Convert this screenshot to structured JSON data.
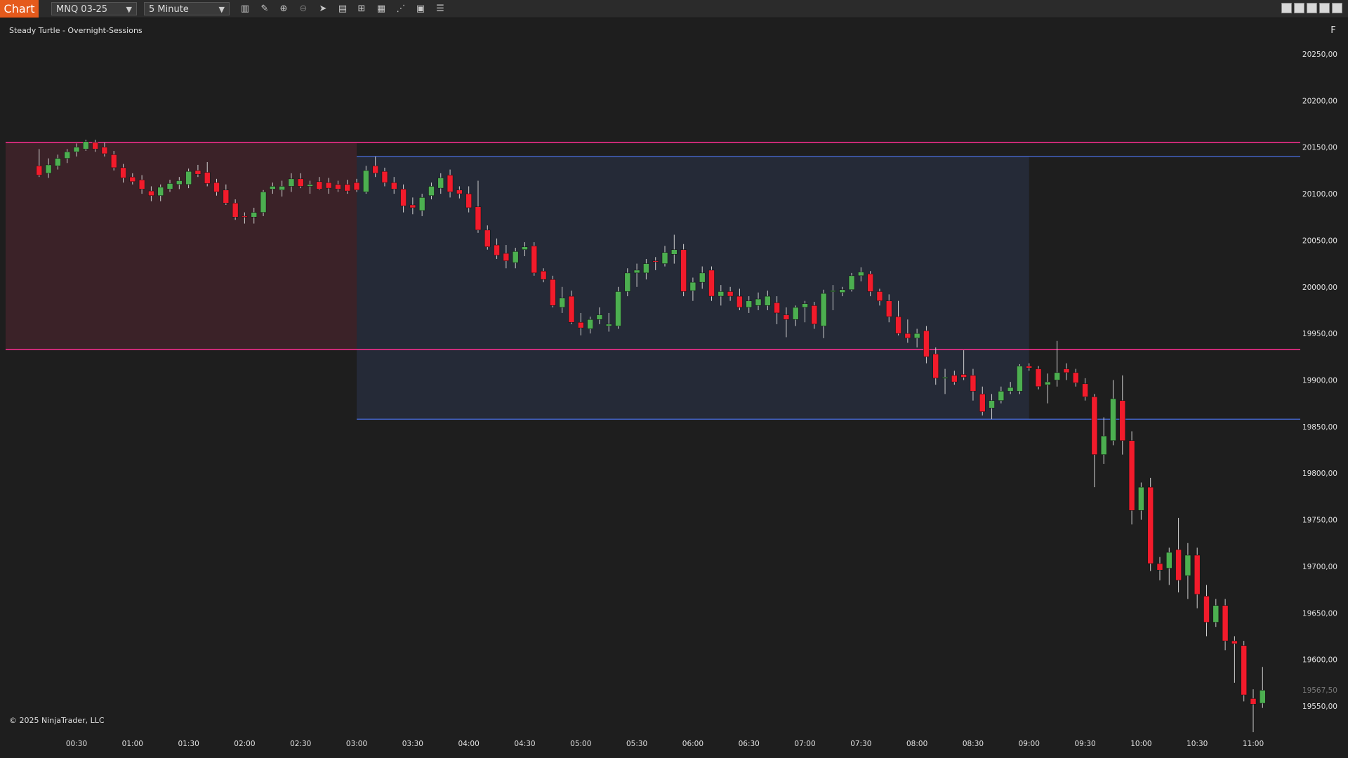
{
  "toolbar": {
    "chart_tab": "Chart",
    "instrument": "MNQ 03-25",
    "interval": "5 Minute",
    "tools": [
      "bars-icon",
      "draw-icon",
      "zoom-in-icon",
      "zoom-out-icon",
      "pointer-icon",
      "data-box-icon",
      "properties-icon",
      "templates-icon",
      "strategies-icon",
      "indicators-icon",
      "list-icon"
    ]
  },
  "indicator_label": "Steady Turtle - Overnight-Sessions",
  "copyright": "© 2025 NinjaTrader, LLC",
  "f_button": "F",
  "colors": {
    "background": "#1e1e1e",
    "up_candle": "#4caf50",
    "down_candle": "#f21b2b",
    "session_red_zone": "#3b2228",
    "session_blue_zone": "#252a37",
    "magenta_line": "#ff2f92",
    "blue_line": "#4a6fe0"
  },
  "chart_data": {
    "type": "candlestick",
    "title": "",
    "y_ticks": [
      "20250,00",
      "20200,00",
      "20150,00",
      "20100,00",
      "20050,00",
      "20000,00",
      "19950,00",
      "19900,00",
      "19850,00",
      "19800,00",
      "19750,00",
      "19700,00",
      "19650,00",
      "19600,00",
      "19550,00"
    ],
    "current_price_label": "19567,50",
    "x_ticks": [
      "00:30",
      "01:00",
      "01:30",
      "02:00",
      "02:30",
      "03:00",
      "03:30",
      "04:00",
      "04:30",
      "05:00",
      "05:30",
      "06:00",
      "06:30",
      "07:00",
      "07:30",
      "08:00",
      "08:30",
      "09:00",
      "09:30",
      "10:00",
      "10:30",
      "11:00"
    ],
    "ylim": [
      19520,
      20280
    ],
    "levels": {
      "overnight_high": 20155,
      "overnight_low": 19933,
      "range_high": 20140,
      "range_low": 19858
    },
    "zones": [
      {
        "name": "overnight",
        "start": "00:00",
        "end": "03:00",
        "top": 20155,
        "bottom": 19933
      },
      {
        "name": "london",
        "start": "03:00",
        "end": "09:00",
        "top": 20140,
        "bottom": 19858
      }
    ],
    "candles": [
      [
        "00:10",
        20130,
        20148,
        20118,
        20120
      ],
      [
        "00:15",
        20122,
        20138,
        20117,
        20131
      ],
      [
        "00:20",
        20130,
        20142,
        20126,
        20138
      ],
      [
        "00:25",
        20138,
        20148,
        20133,
        20145
      ],
      [
        "00:30",
        20145,
        20154,
        20140,
        20150
      ],
      [
        "00:35",
        20148,
        20158,
        20146,
        20156
      ],
      [
        "00:40",
        20155,
        20158,
        20145,
        20148
      ],
      [
        "00:45",
        20150,
        20155,
        20140,
        20143
      ],
      [
        "00:50",
        20142,
        20146,
        20125,
        20128
      ],
      [
        "00:55",
        20128,
        20132,
        20112,
        20117
      ],
      [
        "01:00",
        20118,
        20122,
        20110,
        20113
      ],
      [
        "01:05",
        20115,
        20120,
        20100,
        20105
      ],
      [
        "01:10",
        20103,
        20108,
        20092,
        20098
      ],
      [
        "01:15",
        20098,
        20110,
        20092,
        20107
      ],
      [
        "01:20",
        20105,
        20115,
        20102,
        20111
      ],
      [
        "01:25",
        20110,
        20118,
        20105,
        20114
      ],
      [
        "01:30",
        20110,
        20127,
        20106,
        20124
      ],
      [
        "01:35",
        20125,
        20131,
        20118,
        20121
      ],
      [
        "01:40",
        20123,
        20134,
        20108,
        20111
      ],
      [
        "01:45",
        20112,
        20116,
        20098,
        20102
      ],
      [
        "01:50",
        20104,
        20110,
        20088,
        20090
      ],
      [
        "01:55",
        20090,
        20094,
        20072,
        20075
      ],
      [
        "02:00",
        20076,
        20080,
        20068,
        20075
      ],
      [
        "02:05",
        20075,
        20085,
        20068,
        20080
      ],
      [
        "02:10",
        20080,
        20104,
        20076,
        20102
      ],
      [
        "02:15",
        20105,
        20112,
        20100,
        20108
      ],
      [
        "02:20",
        20104,
        20114,
        20097,
        20108
      ],
      [
        "02:25",
        20108,
        20122,
        20102,
        20116
      ],
      [
        "02:30",
        20116,
        20122,
        20106,
        20108
      ],
      [
        "02:35",
        20108,
        20114,
        20100,
        20110
      ],
      [
        "02:40",
        20113,
        20118,
        20104,
        20105
      ],
      [
        "02:45",
        20112,
        20117,
        20100,
        20106
      ],
      [
        "02:50",
        20110,
        20114,
        20102,
        20105
      ],
      [
        "02:55",
        20110,
        20115,
        20100,
        20103
      ],
      [
        "03:00",
        20112,
        20116,
        20102,
        20104
      ],
      [
        "03:05",
        20102,
        20130,
        20100,
        20125
      ],
      [
        "03:10",
        20130,
        20140,
        20118,
        20122
      ],
      [
        "03:15",
        20124,
        20128,
        20108,
        20112
      ],
      [
        "03:20",
        20112,
        20118,
        20100,
        20105
      ],
      [
        "03:25",
        20105,
        20110,
        20080,
        20087
      ],
      [
        "03:30",
        20088,
        20096,
        20078,
        20085
      ],
      [
        "03:35",
        20082,
        20100,
        20076,
        20096
      ],
      [
        "03:40",
        20098,
        20112,
        20094,
        20108
      ],
      [
        "03:45",
        20106,
        20122,
        20100,
        20117
      ],
      [
        "03:50",
        20120,
        20126,
        20096,
        20102
      ],
      [
        "03:55",
        20104,
        20108,
        20095,
        20100
      ],
      [
        "04:00",
        20100,
        20108,
        20080,
        20085
      ],
      [
        "04:05",
        20086,
        20114,
        20058,
        20061
      ],
      [
        "04:10",
        20061,
        20066,
        20040,
        20043
      ],
      [
        "04:15",
        20045,
        20052,
        20030,
        20034
      ],
      [
        "04:20",
        20036,
        20045,
        20020,
        20028
      ],
      [
        "04:25",
        20026,
        20042,
        20020,
        20038
      ],
      [
        "04:30",
        20040,
        20048,
        20033,
        20043
      ],
      [
        "04:35",
        20044,
        20048,
        20012,
        20015
      ],
      [
        "04:40",
        20017,
        20020,
        20005,
        20008
      ],
      [
        "04:45",
        20008,
        20012,
        19978,
        19980
      ],
      [
        "04:50",
        19978,
        20000,
        19972,
        19988
      ],
      [
        "04:55",
        19990,
        19996,
        19960,
        19962
      ],
      [
        "05:00",
        19962,
        19972,
        19948,
        19956
      ],
      [
        "05:05",
        19955,
        19968,
        19950,
        19965
      ],
      [
        "05:10",
        19965,
        19978,
        19960,
        19970
      ],
      [
        "05:15",
        19958,
        19972,
        19952,
        19960
      ],
      [
        "05:20",
        19958,
        20000,
        19955,
        19995
      ],
      [
        "05:25",
        19995,
        20020,
        19990,
        20015
      ],
      [
        "05:30",
        20015,
        20025,
        20000,
        20018
      ],
      [
        "05:35",
        20015,
        20030,
        20008,
        20025
      ],
      [
        "05:40",
        20028,
        20032,
        20018,
        20027
      ],
      [
        "05:45",
        20025,
        20044,
        20022,
        20037
      ],
      [
        "05:50",
        20035,
        20056,
        20025,
        20040
      ],
      [
        "05:55",
        20040,
        20046,
        19990,
        19995
      ],
      [
        "06:00",
        19996,
        20010,
        19985,
        20005
      ],
      [
        "06:05",
        20005,
        20022,
        19998,
        20015
      ],
      [
        "06:10",
        20018,
        20022,
        19985,
        19990
      ],
      [
        "06:15",
        19990,
        20002,
        19980,
        19995
      ],
      [
        "06:20",
        19995,
        20000,
        19985,
        19990
      ],
      [
        "06:25",
        19990,
        19998,
        19975,
        19978
      ],
      [
        "06:30",
        19978,
        19990,
        19972,
        19985
      ],
      [
        "06:35",
        19980,
        19994,
        19975,
        19987
      ],
      [
        "06:40",
        19980,
        19996,
        19975,
        19990
      ],
      [
        "06:45",
        19983,
        19990,
        19960,
        19972
      ],
      [
        "06:50",
        19970,
        19978,
        19946,
        19965
      ],
      [
        "06:55",
        19965,
        19980,
        19958,
        19978
      ],
      [
        "07:00",
        19978,
        19985,
        19962,
        19982
      ],
      [
        "07:05",
        19980,
        19984,
        19955,
        19960
      ],
      [
        "07:10",
        19958,
        19997,
        19945,
        19993
      ],
      [
        "07:15",
        19995,
        20002,
        19975,
        19996
      ],
      [
        "07:20",
        19994,
        20000,
        19990,
        19997
      ],
      [
        "07:25",
        19997,
        20015,
        19995,
        20012
      ],
      [
        "07:30",
        20012,
        20021,
        20006,
        20016
      ],
      [
        "07:35",
        20014,
        20017,
        19990,
        19995
      ],
      [
        "07:40",
        19995,
        19998,
        19980,
        19985
      ],
      [
        "07:45",
        19985,
        19992,
        19962,
        19968
      ],
      [
        "07:50",
        19968,
        19985,
        19948,
        19950
      ],
      [
        "07:55",
        19950,
        19965,
        19940,
        19945
      ],
      [
        "08:00",
        19945,
        19955,
        19935,
        19950
      ],
      [
        "08:05",
        19953,
        19958,
        19918,
        19925
      ],
      [
        "08:10",
        19928,
        19935,
        19895,
        19902
      ],
      [
        "08:15",
        19903,
        19912,
        19885,
        19903
      ],
      [
        "08:20",
        19905,
        19910,
        19895,
        19898
      ],
      [
        "08:25",
        19906,
        19932,
        19900,
        19903
      ],
      [
        "08:30",
        19905,
        19912,
        19878,
        19888
      ],
      [
        "08:35",
        19885,
        19893,
        19862,
        19866
      ],
      [
        "08:40",
        19870,
        19885,
        19858,
        19878
      ],
      [
        "08:45",
        19878,
        19893,
        19875,
        19888
      ],
      [
        "08:50",
        19888,
        19898,
        19885,
        19892
      ],
      [
        "08:55",
        19888,
        19917,
        19885,
        19915
      ],
      [
        "09:00",
        19915,
        19918,
        19910,
        19913
      ],
      [
        "09:05",
        19912,
        19915,
        19890,
        19893
      ],
      [
        "09:10",
        19895,
        19907,
        19875,
        19898
      ],
      [
        "09:15",
        19900,
        19942,
        19893,
        19908
      ],
      [
        "09:20",
        19912,
        19918,
        19900,
        19908
      ],
      [
        "09:25",
        19908,
        19912,
        19893,
        19897
      ],
      [
        "09:30",
        19896,
        19902,
        19878,
        19882
      ],
      [
        "09:35",
        19882,
        19885,
        19785,
        19820
      ],
      [
        "09:40",
        19820,
        19860,
        19810,
        19840
      ],
      [
        "09:45",
        19835,
        19900,
        19830,
        19880
      ],
      [
        "09:50",
        19878,
        19905,
        19820,
        19835
      ],
      [
        "09:55",
        19835,
        19845,
        19745,
        19760
      ],
      [
        "10:00",
        19760,
        19790,
        19750,
        19785
      ],
      [
        "10:05",
        19785,
        19795,
        19695,
        19703
      ],
      [
        "10:10",
        19703,
        19710,
        19685,
        19696
      ],
      [
        "10:15",
        19698,
        19720,
        19680,
        19715
      ],
      [
        "10:20",
        19718,
        19752,
        19672,
        19685
      ],
      [
        "10:25",
        19690,
        19725,
        19665,
        19712
      ],
      [
        "10:30",
        19712,
        19720,
        19655,
        19670
      ],
      [
        "10:35",
        19668,
        19680,
        19625,
        19640
      ],
      [
        "10:40",
        19640,
        19665,
        19635,
        19658
      ],
      [
        "10:45",
        19658,
        19665,
        19610,
        19620
      ],
      [
        "10:50",
        19620,
        19625,
        19575,
        19617
      ],
      [
        "10:55",
        19615,
        19620,
        19555,
        19562
      ],
      [
        "11:00",
        19558,
        19568,
        19522,
        19552
      ],
      [
        "11:05",
        19553,
        19592,
        19548,
        19567
      ]
    ]
  }
}
